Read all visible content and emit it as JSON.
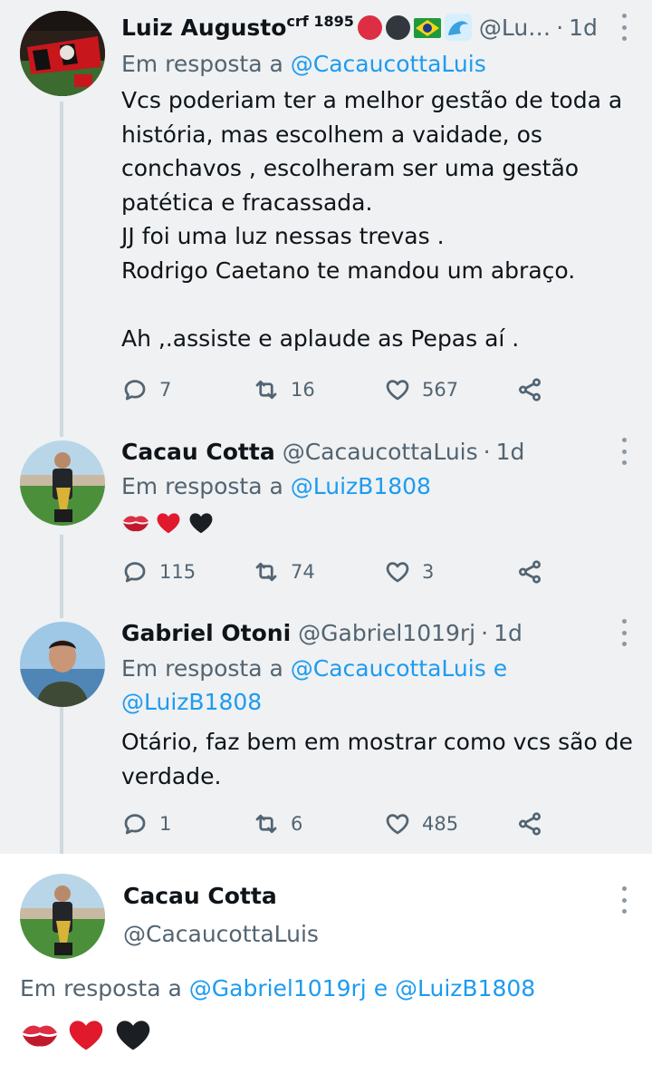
{
  "thread": [
    {
      "name": "Luiz Augusto",
      "name_suffix": "crf 1895",
      "handle": "@Lu…",
      "dot": "·",
      "time": "1d",
      "reply_prefix": "Em resposta a",
      "reply_to": [
        "@CacaucottaLuis"
      ],
      "text_lines": [
        "Vcs poderiam ter a melhor gestão de toda a",
        "história, mas escolhem a vaidade, os",
        "conchavos , escolheram ser uma gestão",
        "patética e fracassada.",
        "JJ foi uma luz nessas trevas .",
        "Rodrigo Caetano te mandou um abraço.",
        "",
        "Ah ,.assiste e aplaude as Pepas aí ."
      ],
      "replies": "7",
      "retweets": "16",
      "likes": "567"
    },
    {
      "name": "Cacau Cotta",
      "handle": "@CacaucottaLuis",
      "dot": "·",
      "time": "1d",
      "reply_prefix": "Em resposta a",
      "reply_to": [
        "@LuizB1808"
      ],
      "emoji": [
        "kiss-mark",
        "red-heart",
        "black-heart"
      ],
      "replies": "115",
      "retweets": "74",
      "likes": "3"
    },
    {
      "name": "Gabriel Otoni",
      "handle": "@Gabriel1019rj",
      "dot": "·",
      "time": "1d",
      "reply_prefix": "Em resposta a",
      "reply_to": [
        "@CacaucottaLuis",
        "@LuizB1808"
      ],
      "conj": "e",
      "text_lines": [
        "Otário, faz bem em mostrar como vcs são de",
        "verdade."
      ],
      "replies": "1",
      "retweets": "6",
      "likes": "485"
    }
  ],
  "focus": {
    "name": "Cacau Cotta",
    "handle": "@CacaucottaLuis",
    "reply_prefix": "Em resposta a",
    "reply_to": [
      "@Gabriel1019rj",
      "@LuizB1808"
    ],
    "conj": "e",
    "emoji": [
      "kiss-mark",
      "red-heart",
      "black-heart"
    ]
  },
  "colors": {
    "thread_bg": "#eff1f3",
    "link": "#1d9bf0",
    "muted": "#536471",
    "heart_red": "#e0192d",
    "brazil_green": "#1e9a3a"
  }
}
